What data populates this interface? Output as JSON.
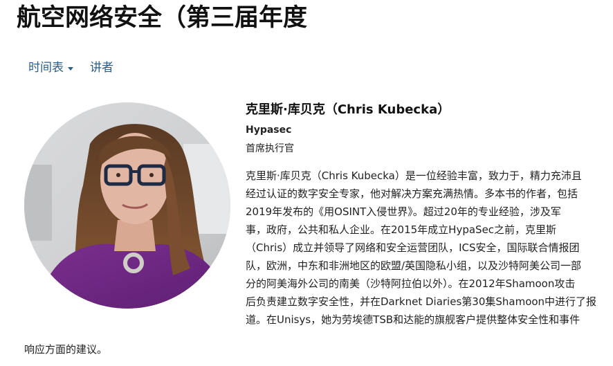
{
  "page": {
    "title": "航空网络安全（第三届年度"
  },
  "nav": {
    "schedule_label": "时间表",
    "speakers_label": "讲者"
  },
  "speaker": {
    "name": "克里斯·库贝克（Chris Kubecka）",
    "company": "Hypasec",
    "role": "首席执行官",
    "bio_lines": [
      "克里斯·库贝克（Chris Kubecka）是一位经验丰富，致力于，精力充沛且",
      "经过认证的数字安全专家，他对解决方案充满热情。多本书的作者，包括",
      "2019年发布的《用OSINT入侵世界》。超过20年的专业经验，涉及军",
      "事，政府，公共和私人企业。在2015年成立HypaSec之前，克里斯",
      "（Chris）成立并领导了网络和安全运营团队，ICS安全，国际联合情报团",
      "队，欧洲，中东和非洲地区的欧盟/英国隐私小组，以及沙特阿美公司一部",
      "分的阿美海外公司的南美（沙特阿拉伯以外）。在2012年Shamoon攻击",
      "后负责建立数字安全性，并在Darknet Diaries第30集Shamoon中进行了报",
      "道。在Unisys，她为劳埃德TSB和达能的旗舰客户提供整体安全性和事件",
      "响应方面的建议。"
    ]
  },
  "colors": {
    "link": "#2a5d8a",
    "text": "#222222",
    "title": "#111111"
  }
}
